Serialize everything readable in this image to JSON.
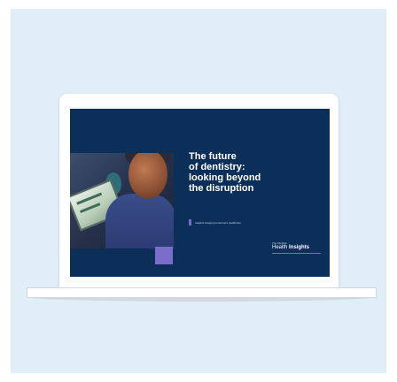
{
  "slide": {
    "headline": "The future\nof dentistry:\nlooking beyond\nthe disruption",
    "subline": "Insights shaping tomorrow's healthcare",
    "brand_small": "The Medical",
    "brand_prefix": "Health",
    "brand_strong": "Insights"
  },
  "colors": {
    "background": "#e0eef8",
    "slide_bg": "#0c2f5a",
    "accent": "#7a6cc9"
  }
}
